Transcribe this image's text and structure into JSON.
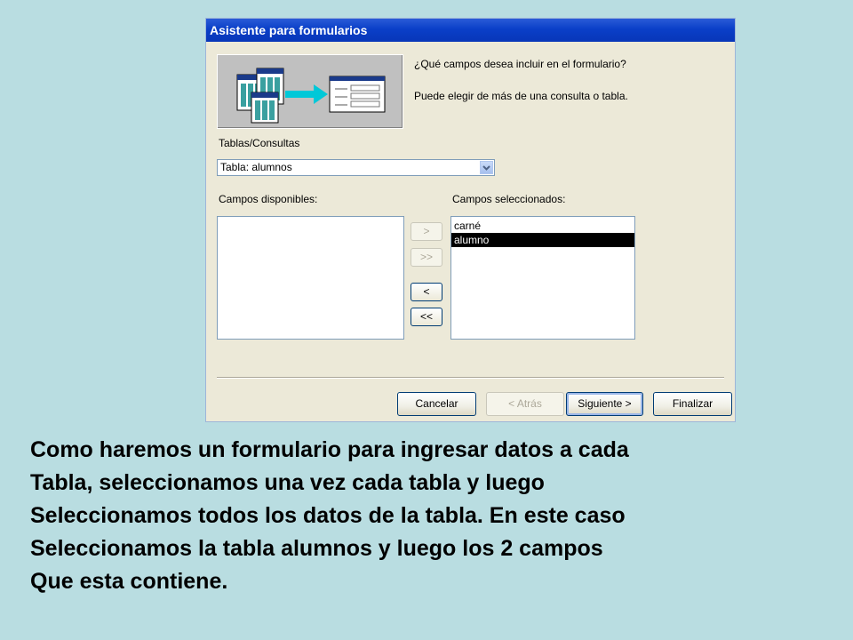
{
  "dialog": {
    "title": "Asistente para formularios",
    "question": "¿Qué campos desea incluir en el formulario?",
    "hint": "Puede elegir de más de una consulta o tabla.",
    "tables_label": "Tablas/Consultas",
    "tables_selected": "Tabla: alumnos",
    "available_label": "Campos disponibles:",
    "available_items": [],
    "selected_label": "Campos seleccionados:",
    "selected_items": [
      {
        "label": "carné",
        "selected": false
      },
      {
        "label": "alumno",
        "selected": true
      }
    ],
    "move_buttons": {
      "add_one": ">",
      "add_all": ">>",
      "remove_one": "<",
      "remove_all": "<<"
    },
    "buttons": {
      "cancel": "Cancelar",
      "back": "< Atrás",
      "next": "Siguiente >",
      "finish": "Finalizar"
    }
  },
  "caption": [
    "Como haremos un formulario para ingresar datos a cada",
    "Tabla, seleccionamos una vez cada tabla y luego",
    "Seleccionamos todos los datos de la tabla. En este caso",
    "Seleccionamos la tabla alumnos y luego los 2 campos",
    "Que esta contiene."
  ],
  "colors": {
    "background": "#b9dde1",
    "dialog": "#ece9d8",
    "titlebar": "#0a3fc8"
  }
}
